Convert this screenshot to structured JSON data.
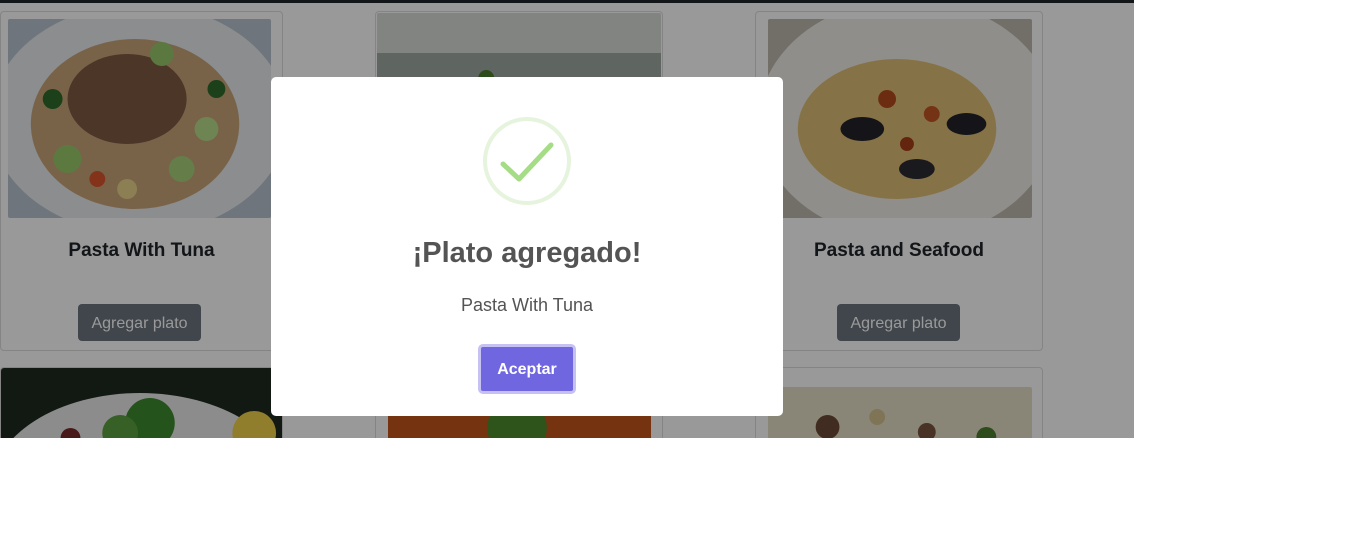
{
  "menu": {
    "cards": [
      {
        "title": "Pasta With Tuna",
        "button": "Agregar plato"
      },
      {
        "title": "",
        "button": ""
      },
      {
        "title": "Pasta and Seafood",
        "button": "Agregar plato"
      }
    ]
  },
  "modal": {
    "title": "¡Plato agregado!",
    "text": "Pasta With Tuna",
    "confirm": "Aceptar",
    "icon": "success-check-icon"
  },
  "colors": {
    "accent": "#7066e0",
    "success": "#a5dc86",
    "button_secondary": "#6c757d"
  }
}
